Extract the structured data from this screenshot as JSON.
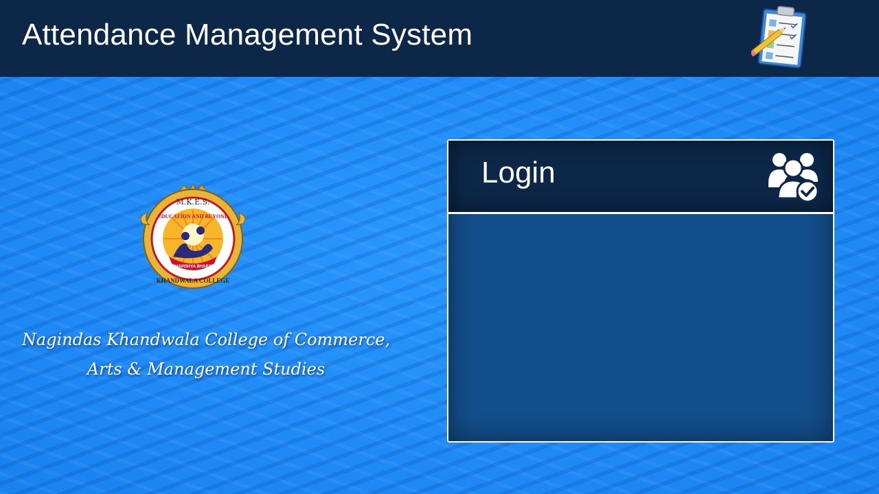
{
  "header": {
    "title": "Attendance Management System",
    "icon": "attendance-clipboard-icon"
  },
  "college": {
    "logo": {
      "icon": "college-logo",
      "top_text": "M.K.E.S.",
      "ring_text": "EDUCATION AND BEYOND",
      "banner_text": "BHAVISHYA BHARAT",
      "bottom_text": "KHANDWALA COLLEGE"
    },
    "name_line1": "Nagindas Khandwala College of Commerce,",
    "name_line2": "Arts & Management Studies"
  },
  "login": {
    "title": "Login",
    "icon": "users-check-icon"
  },
  "colors": {
    "header_bg": "#0c2748",
    "page_bg": "#1f8fff",
    "panel_bg": "#134e8c",
    "text": "#ffffff"
  }
}
